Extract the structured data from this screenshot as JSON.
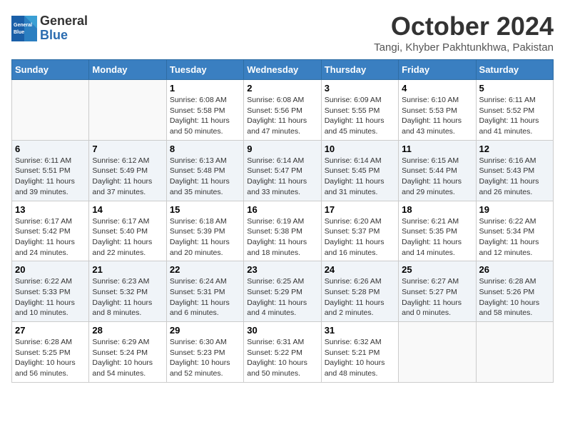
{
  "header": {
    "logo_general": "General",
    "logo_blue": "Blue",
    "month_title": "October 2024",
    "subtitle": "Tangi, Khyber Pakhtunkhwa, Pakistan"
  },
  "weekdays": [
    "Sunday",
    "Monday",
    "Tuesday",
    "Wednesday",
    "Thursday",
    "Friday",
    "Saturday"
  ],
  "weeks": [
    [
      {
        "day": "",
        "info": ""
      },
      {
        "day": "",
        "info": ""
      },
      {
        "day": "1",
        "info": "Sunrise: 6:08 AM\nSunset: 5:58 PM\nDaylight: 11 hours and 50 minutes."
      },
      {
        "day": "2",
        "info": "Sunrise: 6:08 AM\nSunset: 5:56 PM\nDaylight: 11 hours and 47 minutes."
      },
      {
        "day": "3",
        "info": "Sunrise: 6:09 AM\nSunset: 5:55 PM\nDaylight: 11 hours and 45 minutes."
      },
      {
        "day": "4",
        "info": "Sunrise: 6:10 AM\nSunset: 5:53 PM\nDaylight: 11 hours and 43 minutes."
      },
      {
        "day": "5",
        "info": "Sunrise: 6:11 AM\nSunset: 5:52 PM\nDaylight: 11 hours and 41 minutes."
      }
    ],
    [
      {
        "day": "6",
        "info": "Sunrise: 6:11 AM\nSunset: 5:51 PM\nDaylight: 11 hours and 39 minutes."
      },
      {
        "day": "7",
        "info": "Sunrise: 6:12 AM\nSunset: 5:49 PM\nDaylight: 11 hours and 37 minutes."
      },
      {
        "day": "8",
        "info": "Sunrise: 6:13 AM\nSunset: 5:48 PM\nDaylight: 11 hours and 35 minutes."
      },
      {
        "day": "9",
        "info": "Sunrise: 6:14 AM\nSunset: 5:47 PM\nDaylight: 11 hours and 33 minutes."
      },
      {
        "day": "10",
        "info": "Sunrise: 6:14 AM\nSunset: 5:45 PM\nDaylight: 11 hours and 31 minutes."
      },
      {
        "day": "11",
        "info": "Sunrise: 6:15 AM\nSunset: 5:44 PM\nDaylight: 11 hours and 29 minutes."
      },
      {
        "day": "12",
        "info": "Sunrise: 6:16 AM\nSunset: 5:43 PM\nDaylight: 11 hours and 26 minutes."
      }
    ],
    [
      {
        "day": "13",
        "info": "Sunrise: 6:17 AM\nSunset: 5:42 PM\nDaylight: 11 hours and 24 minutes."
      },
      {
        "day": "14",
        "info": "Sunrise: 6:17 AM\nSunset: 5:40 PM\nDaylight: 11 hours and 22 minutes."
      },
      {
        "day": "15",
        "info": "Sunrise: 6:18 AM\nSunset: 5:39 PM\nDaylight: 11 hours and 20 minutes."
      },
      {
        "day": "16",
        "info": "Sunrise: 6:19 AM\nSunset: 5:38 PM\nDaylight: 11 hours and 18 minutes."
      },
      {
        "day": "17",
        "info": "Sunrise: 6:20 AM\nSunset: 5:37 PM\nDaylight: 11 hours and 16 minutes."
      },
      {
        "day": "18",
        "info": "Sunrise: 6:21 AM\nSunset: 5:35 PM\nDaylight: 11 hours and 14 minutes."
      },
      {
        "day": "19",
        "info": "Sunrise: 6:22 AM\nSunset: 5:34 PM\nDaylight: 11 hours and 12 minutes."
      }
    ],
    [
      {
        "day": "20",
        "info": "Sunrise: 6:22 AM\nSunset: 5:33 PM\nDaylight: 11 hours and 10 minutes."
      },
      {
        "day": "21",
        "info": "Sunrise: 6:23 AM\nSunset: 5:32 PM\nDaylight: 11 hours and 8 minutes."
      },
      {
        "day": "22",
        "info": "Sunrise: 6:24 AM\nSunset: 5:31 PM\nDaylight: 11 hours and 6 minutes."
      },
      {
        "day": "23",
        "info": "Sunrise: 6:25 AM\nSunset: 5:29 PM\nDaylight: 11 hours and 4 minutes."
      },
      {
        "day": "24",
        "info": "Sunrise: 6:26 AM\nSunset: 5:28 PM\nDaylight: 11 hours and 2 minutes."
      },
      {
        "day": "25",
        "info": "Sunrise: 6:27 AM\nSunset: 5:27 PM\nDaylight: 11 hours and 0 minutes."
      },
      {
        "day": "26",
        "info": "Sunrise: 6:28 AM\nSunset: 5:26 PM\nDaylight: 10 hours and 58 minutes."
      }
    ],
    [
      {
        "day": "27",
        "info": "Sunrise: 6:28 AM\nSunset: 5:25 PM\nDaylight: 10 hours and 56 minutes."
      },
      {
        "day": "28",
        "info": "Sunrise: 6:29 AM\nSunset: 5:24 PM\nDaylight: 10 hours and 54 minutes."
      },
      {
        "day": "29",
        "info": "Sunrise: 6:30 AM\nSunset: 5:23 PM\nDaylight: 10 hours and 52 minutes."
      },
      {
        "day": "30",
        "info": "Sunrise: 6:31 AM\nSunset: 5:22 PM\nDaylight: 10 hours and 50 minutes."
      },
      {
        "day": "31",
        "info": "Sunrise: 6:32 AM\nSunset: 5:21 PM\nDaylight: 10 hours and 48 minutes."
      },
      {
        "day": "",
        "info": ""
      },
      {
        "day": "",
        "info": ""
      }
    ]
  ]
}
